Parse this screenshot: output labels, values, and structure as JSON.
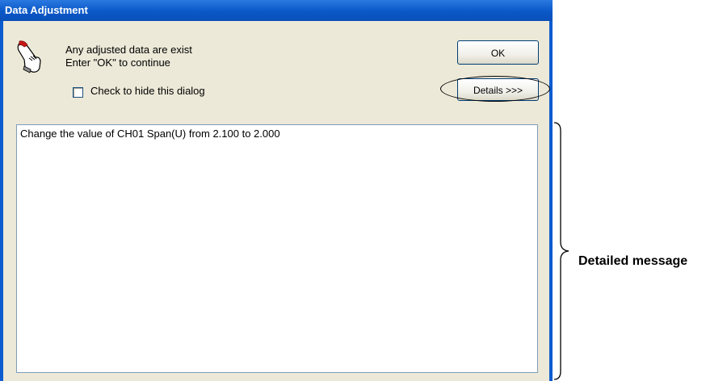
{
  "window": {
    "title": "Data Adjustment"
  },
  "message": {
    "line1": "Any adjusted data are exist",
    "line2": "Enter \"OK\" to continue",
    "icon": "pointing-hand-icon"
  },
  "checkbox": {
    "label": "Check to hide this dialog",
    "checked": false
  },
  "buttons": {
    "ok_label": "OK",
    "details_label": "Details >>>"
  },
  "details": {
    "text": "Change the value of CH01 Span(U) from 2.100 to 2.000"
  },
  "annotation": {
    "label": "Detailed message"
  },
  "colors": {
    "titlebar": "#0a58c8",
    "dialog_bg": "#ece9d8"
  }
}
